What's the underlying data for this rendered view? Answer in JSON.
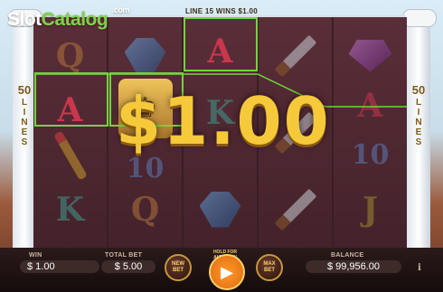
{
  "logo": {
    "slot": "Slot",
    "catalog": "Catalog",
    "com": ".com"
  },
  "top_info": "LINE 15 WINS $1.00",
  "side_labels": {
    "left_num": "50",
    "left_text": "LINES",
    "right_num": "50",
    "right_text": "LINES"
  },
  "reels": [
    [
      "Q",
      "scepter",
      "K"
    ],
    [
      "gem-blue",
      "king",
      "Q"
    ],
    [
      "A",
      "K",
      "gem-blue"
    ],
    [
      "sword",
      "sword",
      "sword"
    ],
    [
      "gem-purple",
      "A",
      "J"
    ]
  ],
  "extra_symbols": [
    "10",
    "10",
    "A"
  ],
  "big_win": "$1.00",
  "bottom": {
    "win_label": "WIN",
    "win_value": "$ 1.00",
    "total_bet_label": "TOTAL BET",
    "total_bet_value": "$ 5.00",
    "new_bet": "NEW BET",
    "spin_hint": "HOLD FOR AUTOSPIN",
    "max_bet": "MAX BET",
    "balance_label": "BALANCE",
    "balance_value": "$ 99,956.00",
    "info": "i"
  },
  "colors": {
    "win_line": "#6fd63b",
    "gold": "#f6c93a"
  }
}
